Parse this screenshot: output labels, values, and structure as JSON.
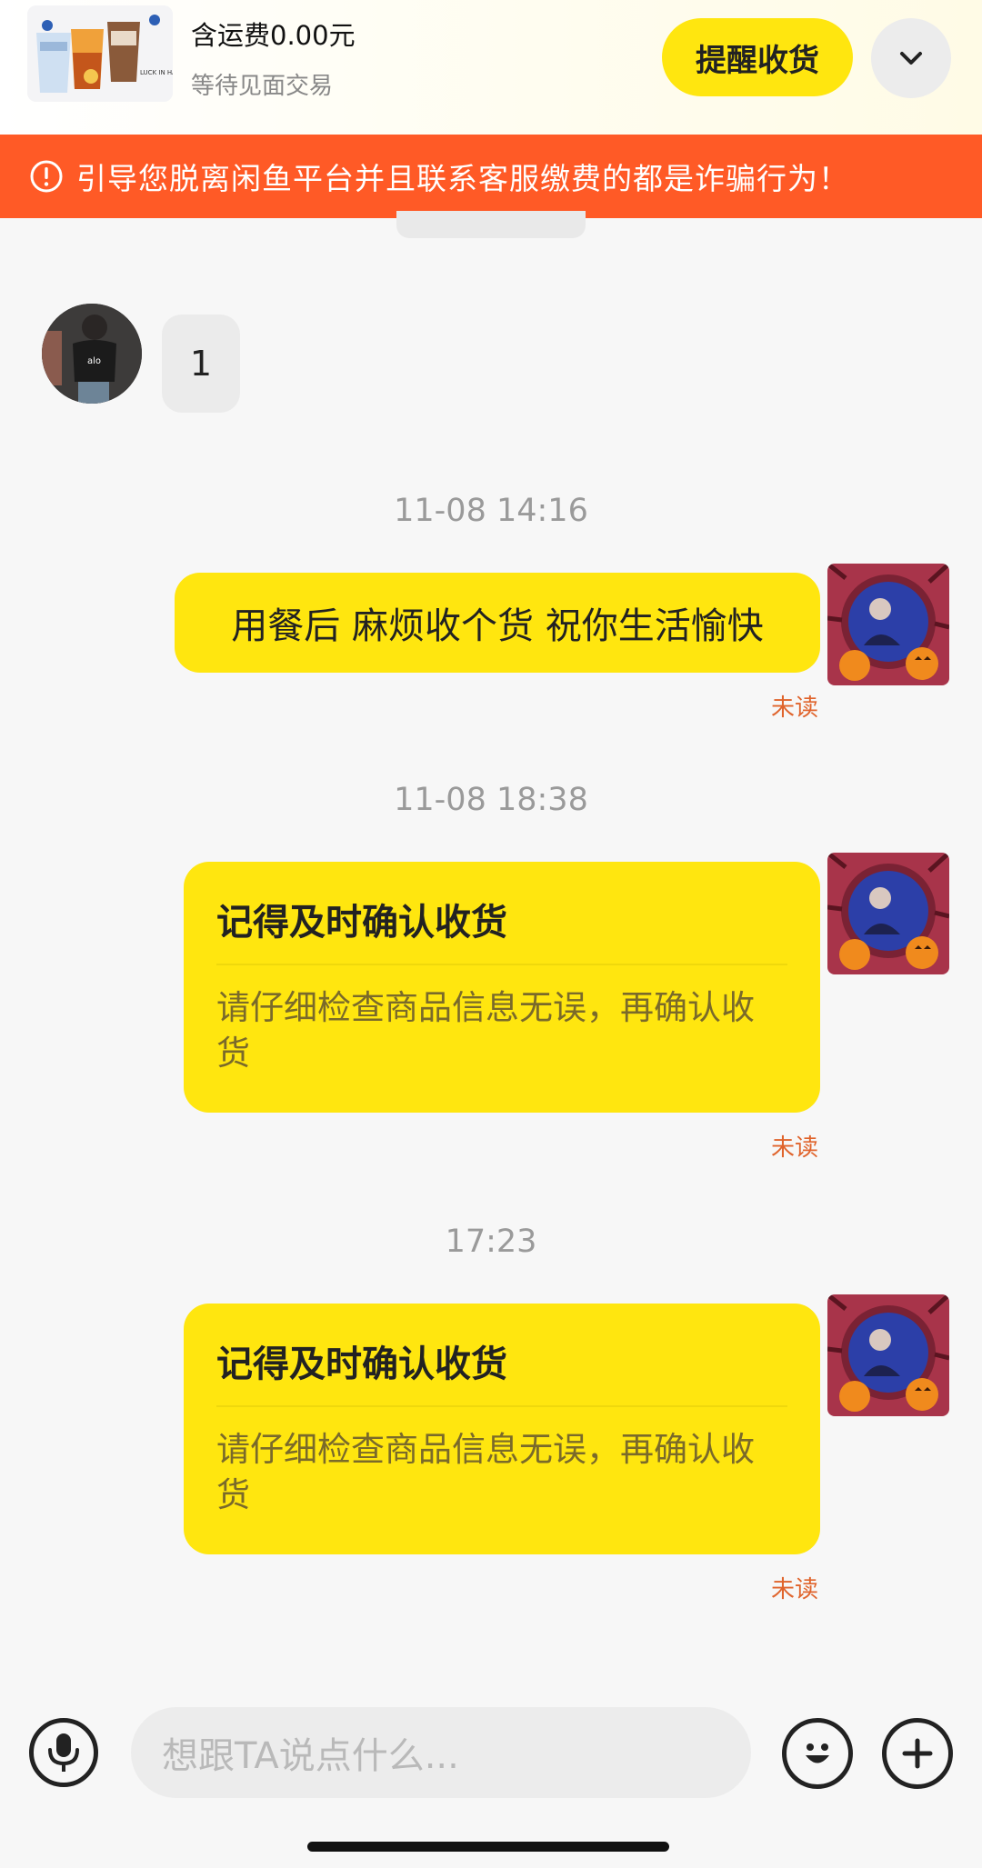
{
  "order": {
    "thumb_icon": "product-thumbnail-drinks",
    "thumb_caption": "LUCK IN HAND",
    "price": "含运费0.00元",
    "status": "等待见面交易",
    "remind_label": "提醒收货",
    "expand_icon": "chevron-down-icon"
  },
  "warning": {
    "icon": "alert-circle-icon",
    "text": "引导您脱离闲鱼平台并且联系客服缴费的都是诈骗行为！"
  },
  "messages": [
    {
      "type": "text",
      "side": "left",
      "avatar": "user-avatar-photo",
      "text": "1"
    },
    {
      "type": "timestamp",
      "text": "11-08 14:16"
    },
    {
      "type": "text",
      "side": "right",
      "avatar": "halloween-avatar",
      "text": "用餐后 麻烦收个货 祝你生活愉快",
      "status": "未读"
    },
    {
      "type": "timestamp",
      "text": "11-08 18:38"
    },
    {
      "type": "card",
      "side": "right",
      "avatar": "halloween-avatar",
      "title": "记得及时确认收货",
      "body": "请仔细检查商品信息无误，再确认收货",
      "status": "未读"
    },
    {
      "type": "timestamp",
      "text": "17:23"
    },
    {
      "type": "card",
      "side": "right",
      "avatar": "halloween-avatar",
      "title": "记得及时确认收货",
      "body": "请仔细检查商品信息无误，再确认收货",
      "status": "未读"
    }
  ],
  "input": {
    "placeholder": "想跟TA说点什么...",
    "voice_icon": "microphone-icon",
    "emoji_icon": "emoji-icon",
    "more_icon": "plus-icon"
  },
  "colors": {
    "brand_yellow": "#ffe60f",
    "warning_orange": "#ff5a26",
    "unread_orange": "#e0642c"
  }
}
